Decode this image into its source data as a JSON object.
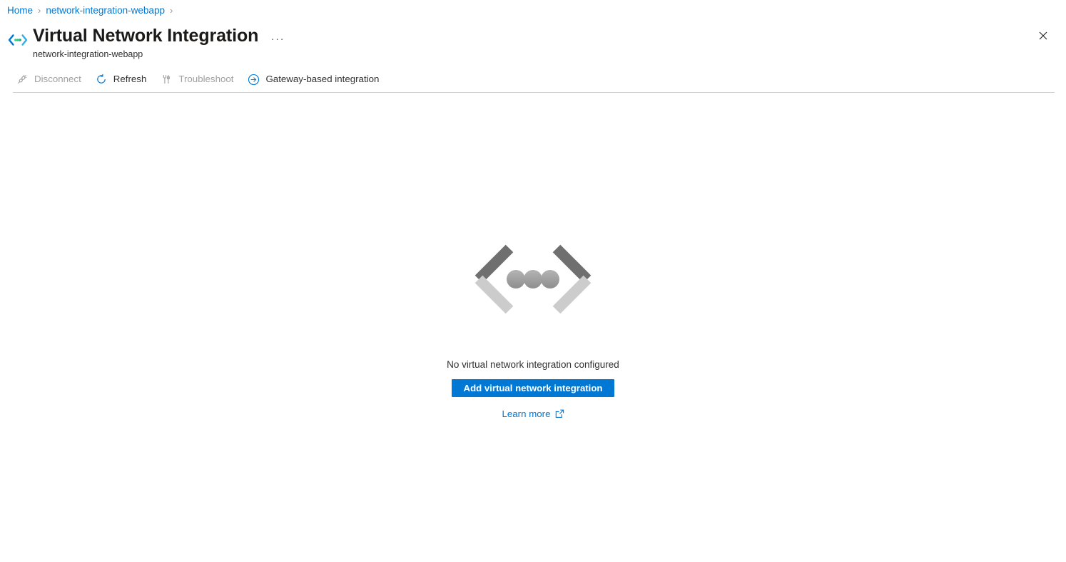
{
  "breadcrumb": {
    "items": [
      {
        "label": "Home"
      },
      {
        "label": "network-integration-webapp"
      }
    ],
    "separator": "›"
  },
  "header": {
    "icon": "virtual-network-integration-icon",
    "title": "Virtual Network Integration",
    "subtitle": "network-integration-webapp",
    "more_label": "···",
    "close_label": "✕"
  },
  "toolbar": {
    "commands": [
      {
        "label": "Disconnect",
        "icon": "disconnect-icon",
        "disabled": true
      },
      {
        "label": "Refresh",
        "icon": "refresh-icon",
        "disabled": false
      },
      {
        "label": "Troubleshoot",
        "icon": "troubleshoot-icon",
        "disabled": true
      },
      {
        "label": "Gateway-based integration",
        "icon": "arrow-circle-right-icon",
        "disabled": false
      }
    ]
  },
  "empty_state": {
    "graphic": "code-brackets-dots-graphic",
    "message": "No virtual network integration configured",
    "primary_button": "Add virtual network integration",
    "learn_more": "Learn more",
    "learn_more_icon": "external-link-icon"
  },
  "colors": {
    "accent": "#0078d4",
    "link": "#0078d4",
    "disabled_text": "#a19f9d",
    "text": "#323130",
    "divider": "#d2d0ce",
    "graphic_dark": "#6f6f6f",
    "graphic_light": "#cccccc"
  }
}
